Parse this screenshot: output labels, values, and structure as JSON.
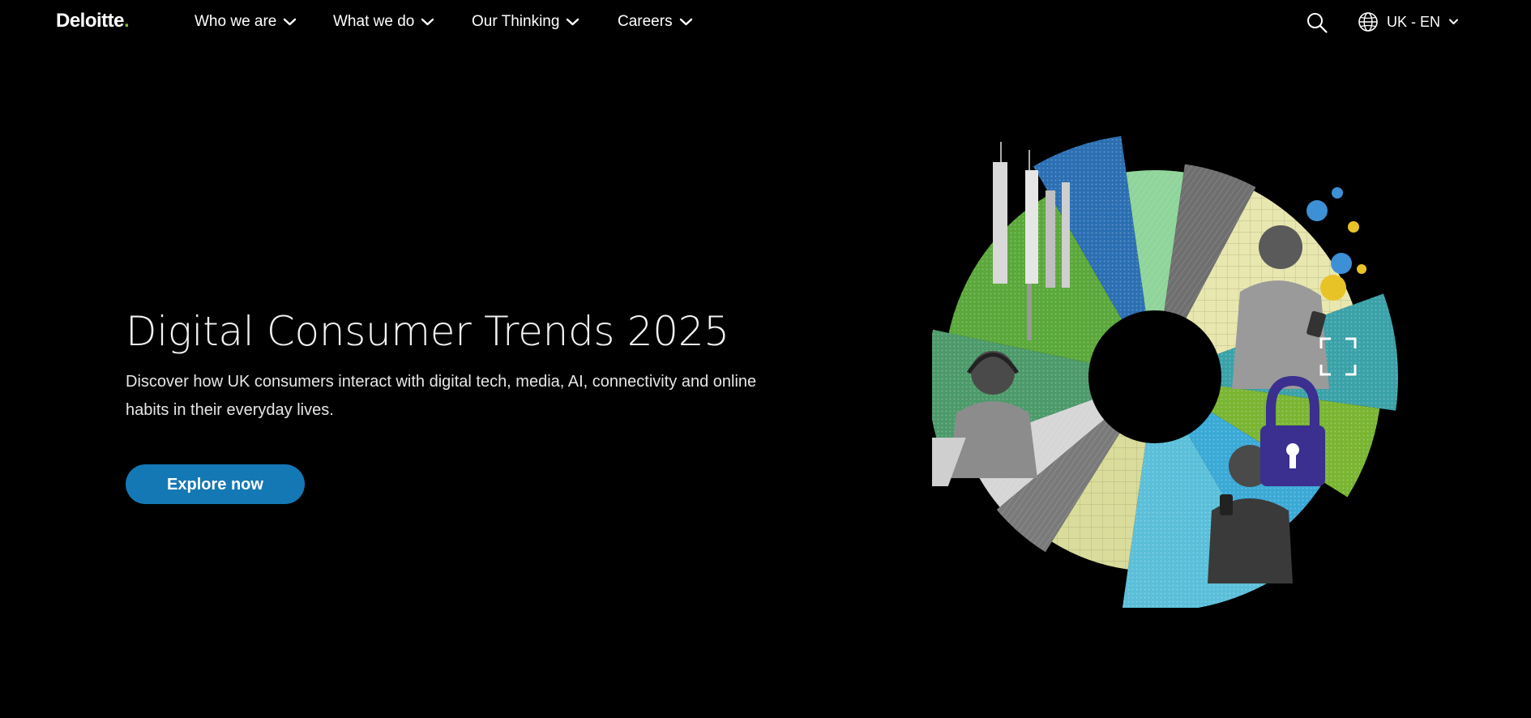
{
  "header": {
    "logo_text": "Deloitte",
    "logo_dot": ".",
    "nav": [
      {
        "label": "Who we are",
        "icon": "chevron-down-icon"
      },
      {
        "label": "What we do",
        "icon": "chevron-down-icon"
      },
      {
        "label": "Our Thinking",
        "icon": "chevron-down-icon"
      },
      {
        "label": "Careers",
        "icon": "chevron-down-icon"
      }
    ],
    "search_icon": "search-icon",
    "language": {
      "label": "UK - EN",
      "icon": "globe-icon"
    }
  },
  "hero": {
    "title": "Digital Consumer Trends 2025",
    "description": "Discover how UK consumers interact with digital tech, media, AI, connectivity and online habits in their everyday lives.",
    "cta_label": "Explore now"
  },
  "colors": {
    "background": "#000000",
    "brand_green": "#86bc25",
    "cta_blue": "#1478b5",
    "text": "#ffffff"
  }
}
